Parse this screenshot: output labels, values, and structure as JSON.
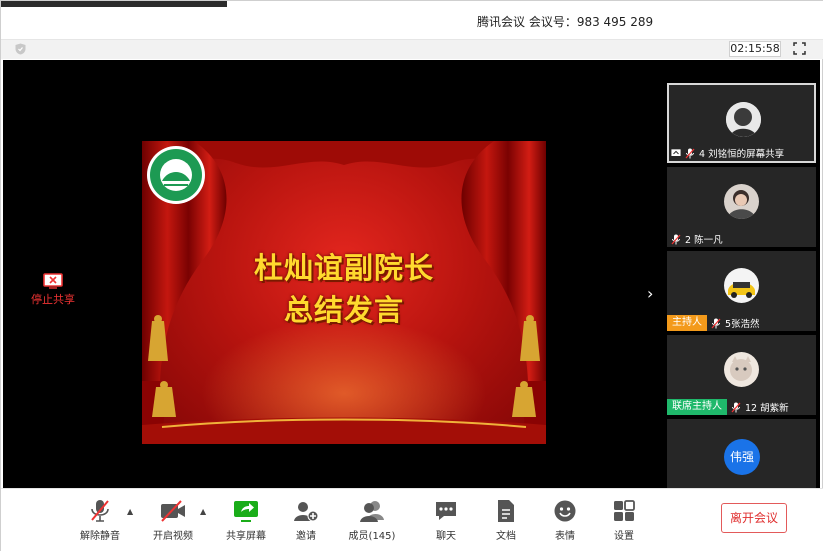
{
  "window": {
    "title": "腾讯会议 会议号：983 495 289"
  },
  "infobar": {
    "timer": "02:15:58",
    "icons": [
      "shield-icon",
      "fullscreen-icon"
    ]
  },
  "share": {
    "stop_label": "停止共享",
    "slide": {
      "line1": "杜灿谊副院长",
      "line2": "总结发言"
    }
  },
  "participants": [
    {
      "name": "4 刘铭恒的屏幕共享",
      "role": "",
      "sharing": true,
      "mic_muted": true
    },
    {
      "name": "2 陈一凡",
      "role": "",
      "mic_muted": true
    },
    {
      "name": "5张浩然",
      "role": "主持人",
      "mic_muted": true
    },
    {
      "name": "12 胡紫新",
      "role": "联席主持人",
      "mic_muted": true
    },
    {
      "name": "",
      "initials": "伟强",
      "role": ""
    }
  ],
  "toolbar": {
    "mute_label": "解除静音",
    "video_label": "开启视频",
    "share_label": "共享屏幕",
    "invite_label": "邀请",
    "members_label": "成员(145)",
    "chat_label": "聊天",
    "docs_label": "文档",
    "emoji_label": "表情",
    "settings_label": "设置",
    "leave_label": "离开会议"
  },
  "colors": {
    "accent_green": "#1aad19",
    "danger_red": "#e03030",
    "host_orange": "#f39a1b",
    "cohost_green": "#1fb86b",
    "avatar_blue": "#1a73e8"
  }
}
